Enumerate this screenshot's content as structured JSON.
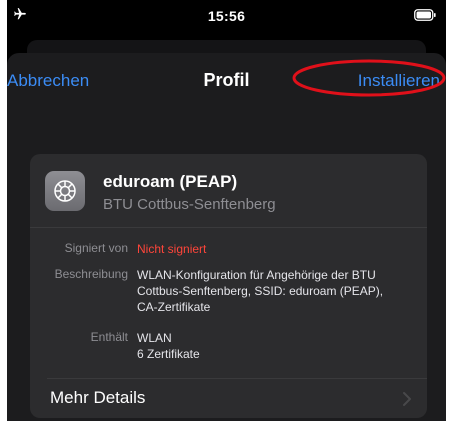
{
  "status_bar": {
    "time": "15:56",
    "airplane_mode": true,
    "airplane_icon": "airplane-icon",
    "battery_icon": "battery-icon"
  },
  "nav": {
    "cancel_label": "Abbrechen",
    "title": "Profil",
    "install_label": "Installieren"
  },
  "profile": {
    "icon": "gear-icon",
    "name": "eduroam (PEAP)",
    "organization": "BTU Cottbus-Senftenberg"
  },
  "details": {
    "signed_label": "Signiert von",
    "signed_value": "Nicht signiert",
    "description_label": "Beschreibung",
    "description_value": "WLAN-Konfiguration für Angehörige der BTU\nCottbus-Senftenberg, SSID: eduroam (PEAP),\nCA-Zertifikate",
    "contains_label": "Enthält",
    "contains_value": "WLAN\n6 Zertifikate"
  },
  "more_details": {
    "label": "Mehr Details",
    "icon": "chevron-right-icon"
  },
  "colors": {
    "accent": "#3b8cf5",
    "warning": "#ff453a",
    "annotation": "#e0101a",
    "sheet_bg": "#1c1c1e",
    "card_bg": "#2c2c2e"
  }
}
